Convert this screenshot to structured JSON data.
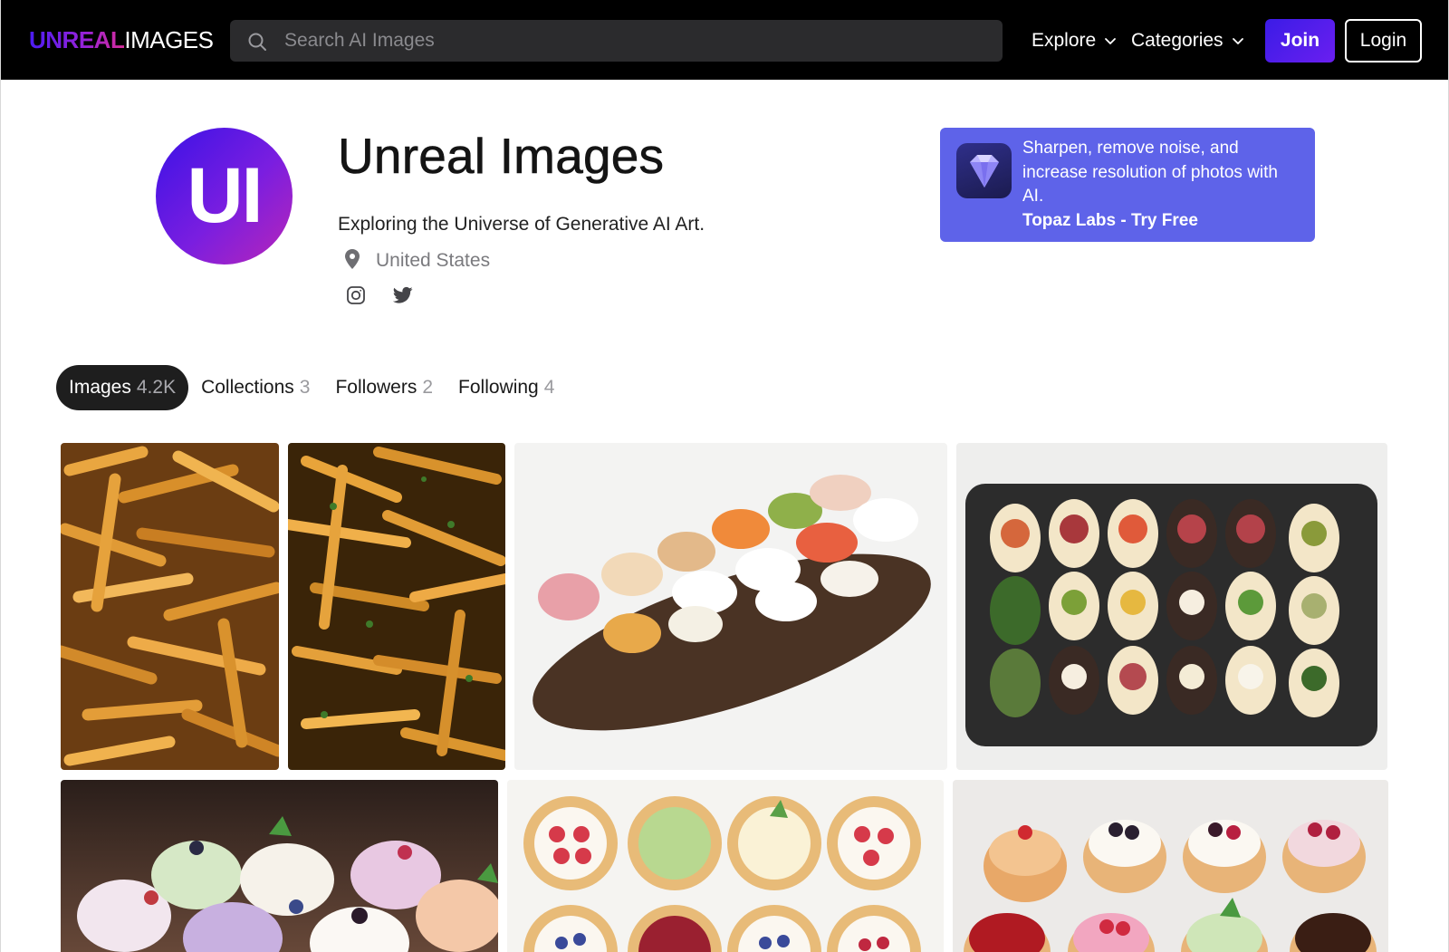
{
  "header": {
    "logo_part1": "UNREAL",
    "logo_part2": "IMAGES",
    "search_placeholder": "Search AI Images",
    "search_icon": "search-icon",
    "nav": [
      {
        "label": "Explore",
        "icon": "chevron-down-icon"
      },
      {
        "label": "Categories",
        "icon": "chevron-down-icon"
      }
    ],
    "join_label": "Join",
    "login_label": "Login"
  },
  "profile": {
    "avatar_initials": "UI",
    "name": "Unreal Images",
    "tagline": "Exploring the Universe of Generative AI Art.",
    "location": "United States",
    "location_icon": "map-pin-icon",
    "socials": [
      {
        "icon": "instagram-icon"
      },
      {
        "icon": "twitter-icon"
      }
    ]
  },
  "ad": {
    "icon": "diamond-gem-icon",
    "text": "Sharpen, remove noise, and increase resolution of photos with AI.",
    "cta": "Topaz Labs - Try Free"
  },
  "tabs": [
    {
      "label": "Images",
      "count": "4.2K",
      "active": true
    },
    {
      "label": "Collections",
      "count": "3",
      "active": false
    },
    {
      "label": "Followers",
      "count": "2",
      "active": false
    },
    {
      "label": "Following",
      "count": "4",
      "active": false
    }
  ],
  "gallery": {
    "images": [
      "french-fries-closeup",
      "seasoned-french-fries",
      "appetizer-platter-board",
      "stuffed-egg-canape-tray",
      "cupcakes-with-berries",
      "fruit-tartlets-top-view",
      "assorted-mini-tarts"
    ]
  },
  "colors": {
    "topbar": "#000000",
    "accent": "#4a1cf2",
    "ad_background": "#5e63e9",
    "active_tab": "#1e1e1e"
  }
}
